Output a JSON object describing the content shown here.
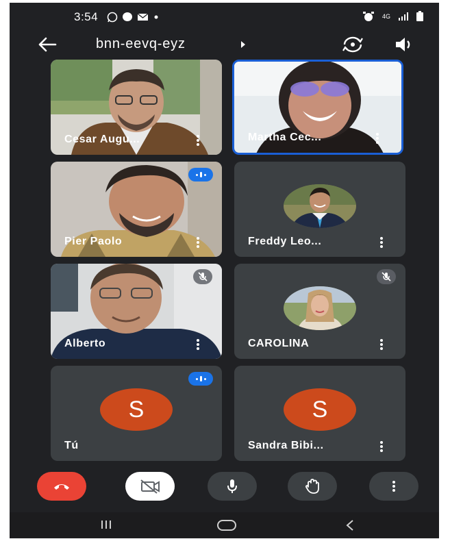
{
  "status_bar": {
    "time": "3:54",
    "network": "4G",
    "icons": [
      "whatsapp-icon",
      "messenger-icon",
      "mail-icon",
      "dot-icon",
      "alarm-icon",
      "network-4g-icon",
      "signal-icon",
      "battery-icon"
    ]
  },
  "header": {
    "meeting_code": "bnn-eevq-eyz",
    "icons": [
      "back-arrow-icon",
      "caret-right-icon",
      "switch-camera-icon",
      "speaker-icon"
    ]
  },
  "participants": [
    {
      "name": "Cesar Augu...",
      "video": true,
      "status": "none",
      "active": false
    },
    {
      "name": "Martha Cec...",
      "video": true,
      "status": "none",
      "active": true
    },
    {
      "name": "Pier Paolo",
      "video": true,
      "status": "speaking",
      "active": false
    },
    {
      "name": "Freddy Leo...",
      "video": false,
      "avatar": "photo",
      "status": "none",
      "active": false
    },
    {
      "name": "Alberto",
      "video": true,
      "status": "muted",
      "active": false
    },
    {
      "name": "CAROLINA",
      "video": false,
      "avatar": "photo",
      "status": "muted",
      "active": false
    },
    {
      "name": "Tú",
      "video": false,
      "avatar": "letter",
      "avatar_letter": "S",
      "status": "speaking",
      "active": false
    },
    {
      "name": "Sandra Bibi...",
      "video": false,
      "avatar": "letter",
      "avatar_letter": "S",
      "status": "none",
      "active": false
    }
  ],
  "controls": [
    "end-call-icon",
    "camera-off-icon",
    "microphone-icon",
    "raise-hand-icon",
    "more-vert-icon"
  ],
  "nav_bar": [
    "recents-icon",
    "home-icon",
    "back-icon"
  ],
  "colors": {
    "background": "#202124",
    "tile": "#3c4043",
    "accent_blue": "#1a73e8",
    "active_border": "#1a5fd6",
    "end_call": "#ea4335",
    "avatar": "#cc4a1c"
  }
}
